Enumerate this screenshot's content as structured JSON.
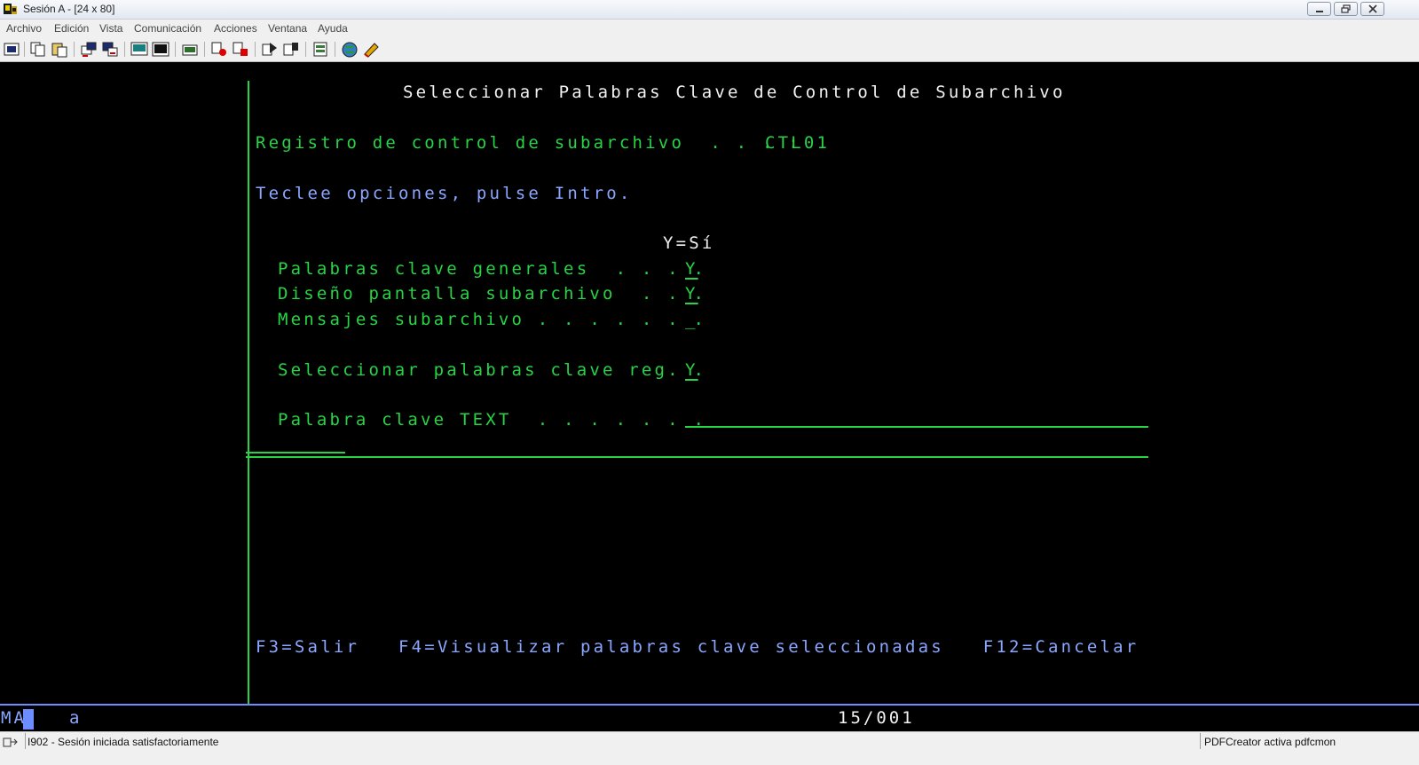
{
  "window": {
    "title": "Sesión A - [24 x 80]"
  },
  "menu": {
    "items": [
      {
        "label": "Archivo"
      },
      {
        "label": "Edición"
      },
      {
        "label": "Vista"
      },
      {
        "label": "Comunicación"
      },
      {
        "label": "Acciones"
      },
      {
        "label": "Ventana"
      },
      {
        "label": "Ayuda"
      }
    ]
  },
  "toolbar": {
    "icons": [
      "print-screen-icon",
      "copy-icon",
      "paste-icon",
      "send-icon",
      "receive-icon",
      "display-icon",
      "keyboard-icon",
      "macro-icon",
      "record-macro-icon",
      "stop-macro-icon",
      "play-macro-icon",
      "pause-macro-icon",
      "clipboard-icon",
      "globe-icon",
      "edit-icon"
    ]
  },
  "screen": {
    "title": "Seleccionar Palabras Clave de Control de Subarchivo",
    "record_label": "Registro de control de subarchivo  . . . :",
    "record_value": "CTL01",
    "instructions": "Teclee opciones, pulse Intro.",
    "column_header": "Y=Sí",
    "options": [
      {
        "label": "Palabras clave generales  . . . .",
        "value": "Y"
      },
      {
        "label": "Diseño pantalla subarchivo  . . .",
        "value": "Y"
      },
      {
        "label": "Mensajes subarchivo . . . . . . .",
        "value": "_"
      },
      {
        "label": "Seleccionar palabras clave reg. .",
        "value": "Y"
      }
    ],
    "text_keyword_label": "Palabra clave TEXT  . . . . . . .",
    "text_keyword_value": "",
    "function_keys": "F3=Salir   F4=Visualizar palabras clave seleccionadas   F12=Cancelar"
  },
  "oia": {
    "mode": "MA",
    "indicator": "a",
    "cursor_position": "15/001"
  },
  "status": {
    "message": "I902 - Sesión iniciada satisfactoriamente",
    "right_text": "PDFCreator activa pdfcmon"
  },
  "colors": {
    "screen_bg": "#000000",
    "field_green": "#27d444",
    "text_blue": "#8aa7ff",
    "text_white": "#f2f2f2"
  }
}
